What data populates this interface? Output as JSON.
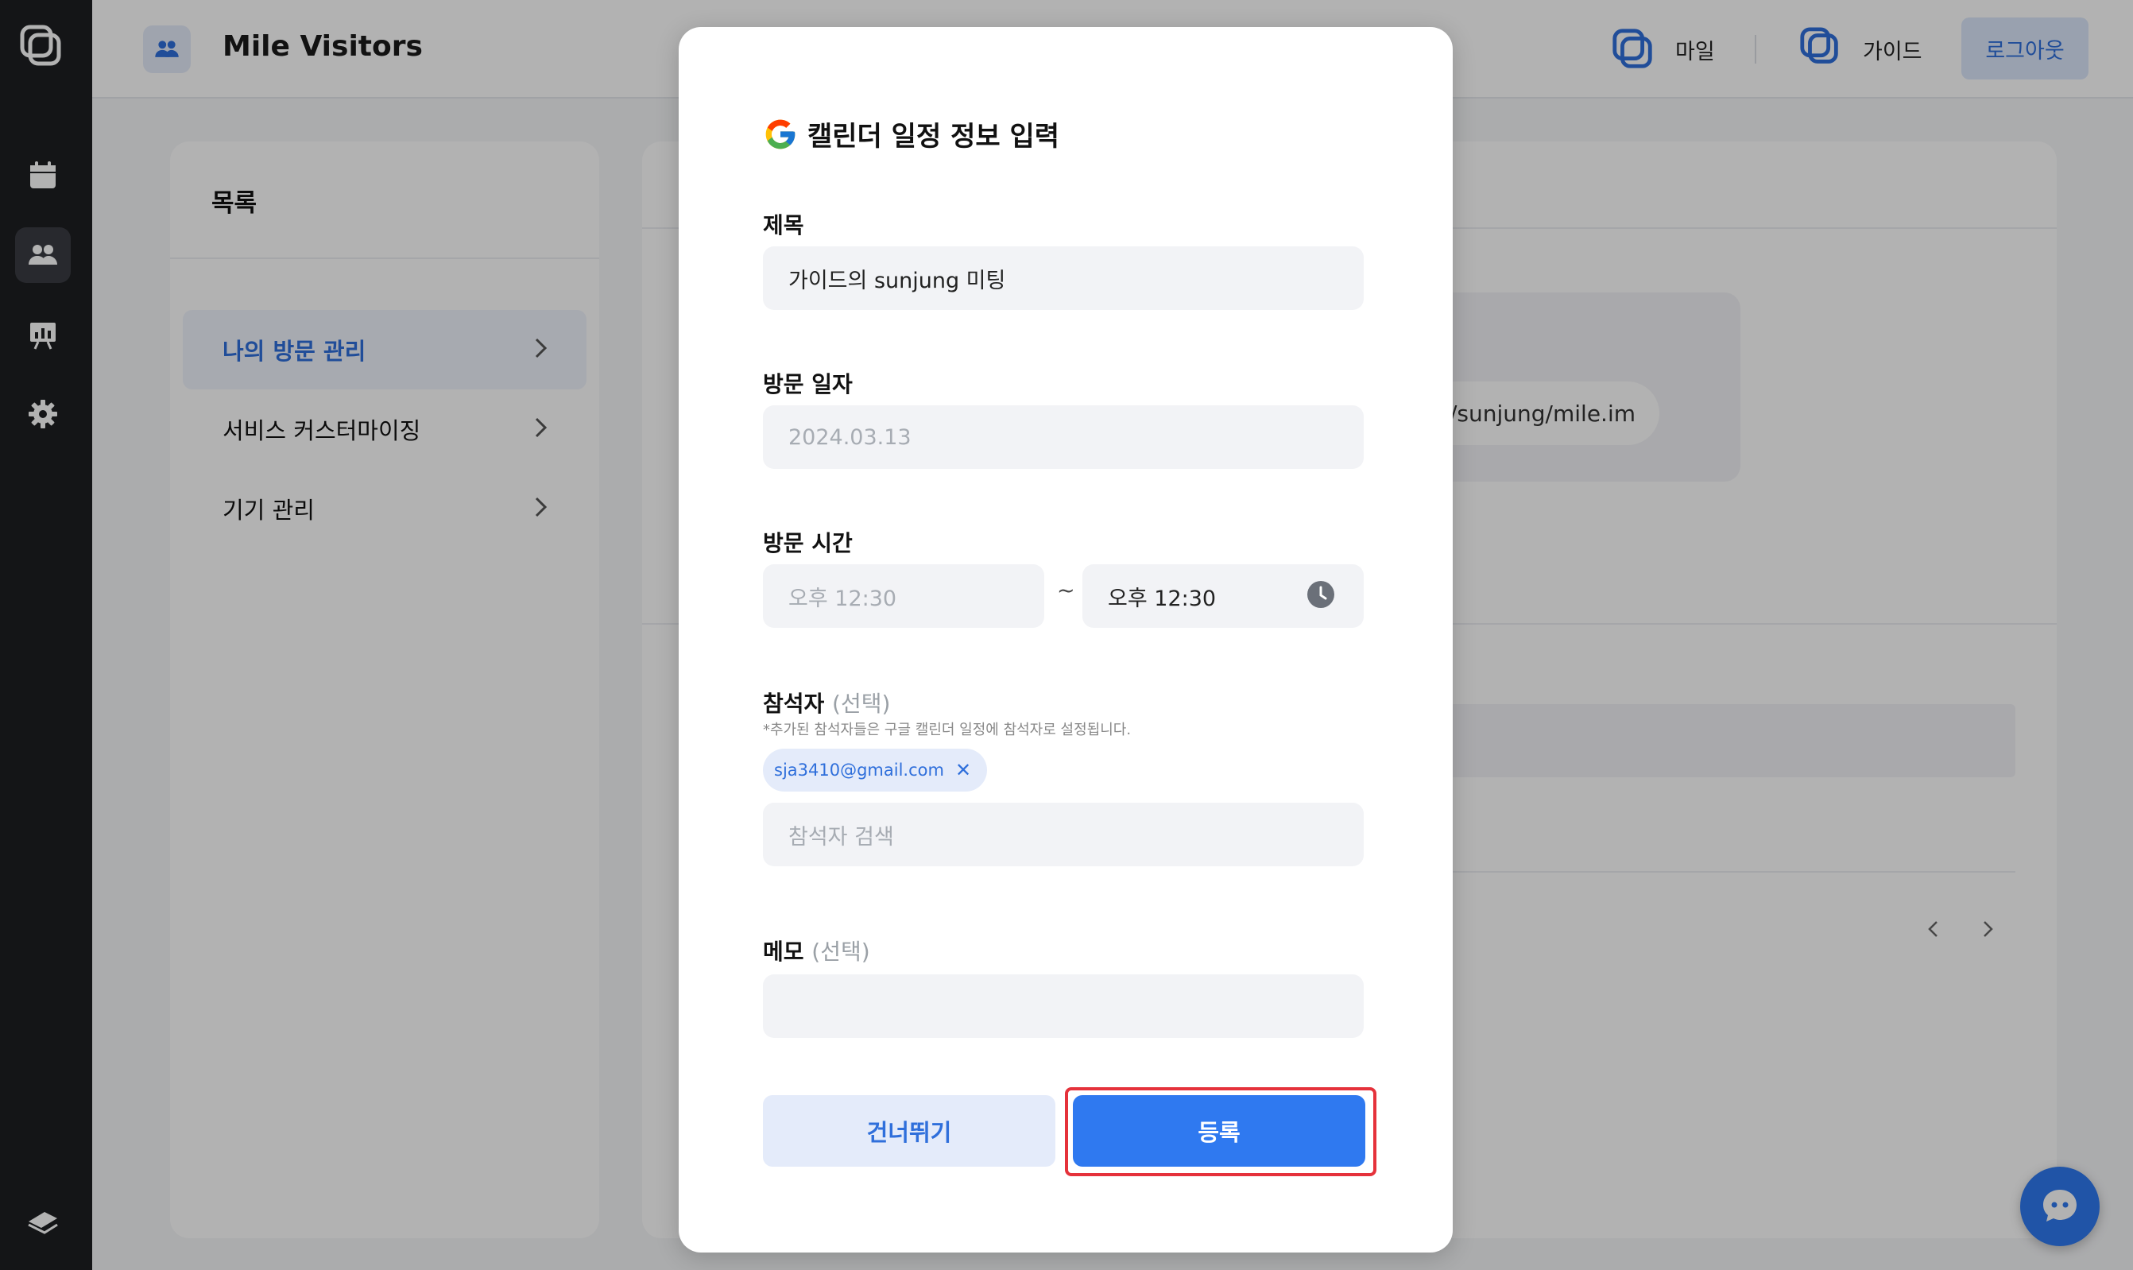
{
  "header": {
    "title": "Mile Visitors",
    "links": [
      {
        "label": "마일"
      },
      {
        "label": "가이드"
      }
    ],
    "logout_label": "로그아웃"
  },
  "sidebar": {
    "title": "목록",
    "items": [
      {
        "label": "나의 방문 관리",
        "active": true
      },
      {
        "label": "서비스 커스터마이징",
        "active": false
      },
      {
        "label": "기기 관리",
        "active": false
      }
    ]
  },
  "main": {
    "url_text": "ile.im/sunjung/mile.im"
  },
  "modal": {
    "title": "캘린더 일정 정보 입력",
    "fields": {
      "title_label": "제목",
      "title_value": "가이드의 sunjung 미팅",
      "date_label": "방문 일자",
      "date_placeholder": "2024.03.13",
      "time_label": "방문 시간",
      "time_start_placeholder": "오후 12:30",
      "time_separator": "~",
      "time_end_value": "오후 12:30",
      "attendees_label": "참석자",
      "attendees_optional": "(선택)",
      "attendees_hint": "*추가된 참석자들은 구글 캘린더 일정에 참석자로 설정됩니다.",
      "attendee_chips": [
        "sja3410@gmail.com"
      ],
      "attendee_remove_glyph": "✕",
      "attendee_search_placeholder": "참석자 검색",
      "memo_label": "메모",
      "memo_optional": "(선택)",
      "memo_value": ""
    },
    "buttons": {
      "skip": "건너뛰기",
      "submit": "등록"
    }
  },
  "colors": {
    "accent": "#2f79f0",
    "accent_text": "#2f6fdb",
    "accent_soft": "#e4ebfa",
    "highlight": "#e5323b",
    "rail": "#1e1f22"
  },
  "icons": [
    "app-logo-icon",
    "calendar-icon",
    "users-icon",
    "presentation-icon",
    "gear-icon",
    "book-icon",
    "google-icon",
    "clock-icon",
    "chevron-right-icon",
    "chat-icon"
  ]
}
